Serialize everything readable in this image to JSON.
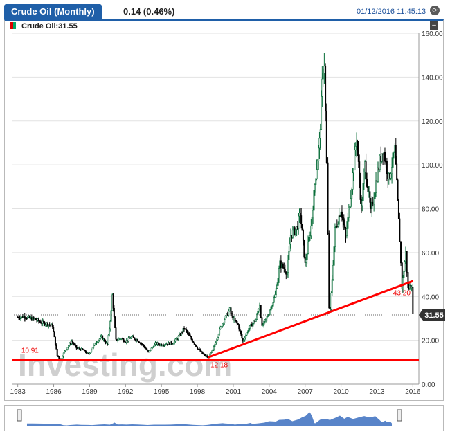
{
  "header": {
    "title": "Crude Oil (Monthly)",
    "change": "0.14 (0.46%)",
    "datetime": "01/12/2016 11:45:13"
  },
  "legend": {
    "label": "Crude Oil:31.55"
  },
  "watermark": {
    "text": "Investing.com"
  },
  "colors": {
    "accent": "#1f5fa8",
    "up": "#0a6e3a",
    "down": "#000000",
    "trend": "#ff0000",
    "priceTag": "#333333"
  },
  "chart_data": {
    "type": "line",
    "title": "Crude Oil (Monthly)",
    "x_ticks": [
      "1983",
      "1986",
      "1989",
      "1992",
      "1995",
      "1998",
      "2001",
      "2004",
      "2007",
      "2010",
      "2013",
      "2016"
    ],
    "y_ticks": [
      "0.00",
      "20.00",
      "40.00",
      "60.00",
      "80.00",
      "100.00",
      "120.00",
      "140.00",
      "160.00"
    ],
    "ylim": [
      0,
      160
    ],
    "xlim": [
      1982.5,
      2016.5
    ],
    "grid": true,
    "last_price": "31.55",
    "series": [
      {
        "name": "Crude Oil",
        "points": [
          [
            1983.0,
            30.5
          ],
          [
            1983.5,
            31.0
          ],
          [
            1984.0,
            30.0
          ],
          [
            1984.5,
            29.5
          ],
          [
            1985.0,
            28.0
          ],
          [
            1985.5,
            27.5
          ],
          [
            1985.9,
            26.5
          ],
          [
            1986.3,
            13.0
          ],
          [
            1986.6,
            11.0
          ],
          [
            1986.9,
            15.0
          ],
          [
            1987.5,
            19.5
          ],
          [
            1987.9,
            16.5
          ],
          [
            1988.5,
            15.5
          ],
          [
            1988.9,
            13.5
          ],
          [
            1989.5,
            19.0
          ],
          [
            1990.0,
            21.5
          ],
          [
            1990.5,
            18.0
          ],
          [
            1990.8,
            33.0
          ],
          [
            1990.9,
            40.5
          ],
          [
            1991.2,
            20.0
          ],
          [
            1991.6,
            21.0
          ],
          [
            1992.0,
            19.5
          ],
          [
            1992.5,
            21.5
          ],
          [
            1993.0,
            20.0
          ],
          [
            1993.5,
            17.5
          ],
          [
            1993.9,
            14.5
          ],
          [
            1994.5,
            18.5
          ],
          [
            1995.0,
            18.0
          ],
          [
            1995.5,
            18.5
          ],
          [
            1996.0,
            19.0
          ],
          [
            1996.5,
            22.0
          ],
          [
            1996.9,
            25.5
          ],
          [
            1997.5,
            20.5
          ],
          [
            1998.0,
            16.5
          ],
          [
            1998.5,
            13.5
          ],
          [
            1998.9,
            12.2
          ],
          [
            1999.3,
            15.5
          ],
          [
            1999.7,
            22.0
          ],
          [
            2000.0,
            27.0
          ],
          [
            2000.7,
            34.0
          ],
          [
            2000.9,
            30.5
          ],
          [
            2001.4,
            27.0
          ],
          [
            2001.8,
            19.5
          ],
          [
            2002.3,
            25.5
          ],
          [
            2002.9,
            29.5
          ],
          [
            2003.2,
            36.5
          ],
          [
            2003.4,
            26.0
          ],
          [
            2003.9,
            31.5
          ],
          [
            2004.5,
            40.5
          ],
          [
            2004.9,
            55.0
          ],
          [
            2005.5,
            51.0
          ],
          [
            2005.8,
            68.0
          ],
          [
            2006.3,
            71.0
          ],
          [
            2006.6,
            78.0
          ],
          [
            2007.0,
            54.5
          ],
          [
            2007.5,
            72.0
          ],
          [
            2007.9,
            96.0
          ],
          [
            2008.2,
            110.0
          ],
          [
            2008.5,
            145.0
          ],
          [
            2008.6,
            147.0
          ],
          [
            2008.8,
            100.0
          ],
          [
            2009.0,
            35.0
          ],
          [
            2009.1,
            33.5
          ],
          [
            2009.5,
            70.0
          ],
          [
            2010.0,
            80.0
          ],
          [
            2010.4,
            67.0
          ],
          [
            2010.9,
            91.0
          ],
          [
            2011.3,
            113.0
          ],
          [
            2011.7,
            80.0
          ],
          [
            2012.0,
            100.0
          ],
          [
            2012.5,
            78.0
          ],
          [
            2013.0,
            95.0
          ],
          [
            2013.5,
            108.0
          ],
          [
            2014.0,
            93.5
          ],
          [
            2014.5,
            107.0
          ],
          [
            2014.9,
            66.0
          ],
          [
            2015.1,
            44.0
          ],
          [
            2015.4,
            60.0
          ],
          [
            2015.6,
            43.5
          ],
          [
            2015.9,
            45.5
          ],
          [
            2016.0,
            31.55
          ]
        ]
      }
    ],
    "trendlines": [
      {
        "from": [
          1998.9,
          12.18
        ],
        "to": [
          2016.0,
          47.0
        ]
      },
      {
        "from": [
          1982.5,
          10.91
        ],
        "to": [
          2016.5,
          10.91
        ]
      }
    ],
    "annotations": [
      "10.91",
      "12.18",
      "43.20"
    ]
  }
}
